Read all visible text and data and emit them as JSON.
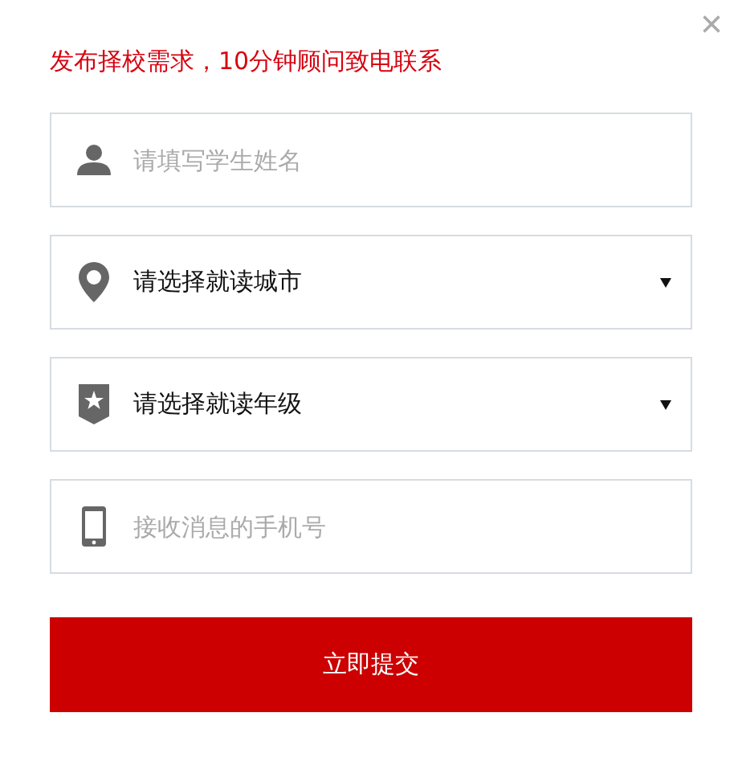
{
  "close": "×",
  "heading": "发布择校需求，10分钟顾问致电联系",
  "fields": [
    {
      "kind": "input",
      "placeholder": "请填写学生姓名"
    },
    {
      "kind": "select",
      "value": "请选择就读城市"
    },
    {
      "kind": "select",
      "value": "请选择就读年级"
    },
    {
      "kind": "input",
      "placeholder": "接收消息的手机号"
    }
  ],
  "submit": "立即提交"
}
